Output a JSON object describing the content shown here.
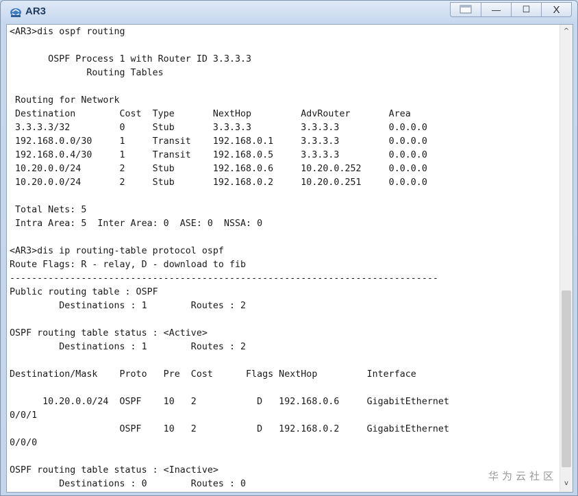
{
  "window": {
    "title": "AR3",
    "icon": "router-app-icon",
    "controls": {
      "restore_glyph": "",
      "minimize_glyph": "—",
      "maximize_glyph": "☐",
      "close_glyph": "X"
    }
  },
  "terminal": {
    "lines": [
      "<AR3>dis ospf routing",
      "",
      "       OSPF Process 1 with Router ID 3.3.3.3",
      "              Routing Tables",
      "",
      " Routing for Network",
      " Destination        Cost  Type       NextHop         AdvRouter       Area",
      " 3.3.3.3/32         0     Stub       3.3.3.3         3.3.3.3         0.0.0.0",
      " 192.168.0.0/30     1     Transit    192.168.0.1     3.3.3.3         0.0.0.0",
      " 192.168.0.4/30     1     Transit    192.168.0.5     3.3.3.3         0.0.0.0",
      " 10.20.0.0/24       2     Stub       192.168.0.6     10.20.0.252     0.0.0.0",
      " 10.20.0.0/24       2     Stub       192.168.0.2     10.20.0.251     0.0.0.0",
      "",
      " Total Nets: 5",
      " Intra Area: 5  Inter Area: 0  ASE: 0  NSSA: 0",
      "",
      "<AR3>dis ip routing-table protocol ospf",
      "Route Flags: R - relay, D - download to fib",
      "------------------------------------------------------------------------------",
      "Public routing table : OSPF",
      "         Destinations : 1        Routes : 2",
      "",
      "OSPF routing table status : <Active>",
      "         Destinations : 1        Routes : 2",
      "",
      "Destination/Mask    Proto   Pre  Cost      Flags NextHop         Interface",
      "",
      "      10.20.0.0/24  OSPF    10   2           D   192.168.0.6     GigabitEthernet",
      "0/0/1",
      "                    OSPF    10   2           D   192.168.0.2     GigabitEthernet",
      "0/0/0",
      "",
      "OSPF routing table status : <Inactive>",
      "         Destinations : 0        Routes : 0"
    ]
  },
  "scrollbar": {
    "up_glyph": "^",
    "down_glyph": "v",
    "position_fraction": 0.57
  },
  "watermark": "华为云社区"
}
